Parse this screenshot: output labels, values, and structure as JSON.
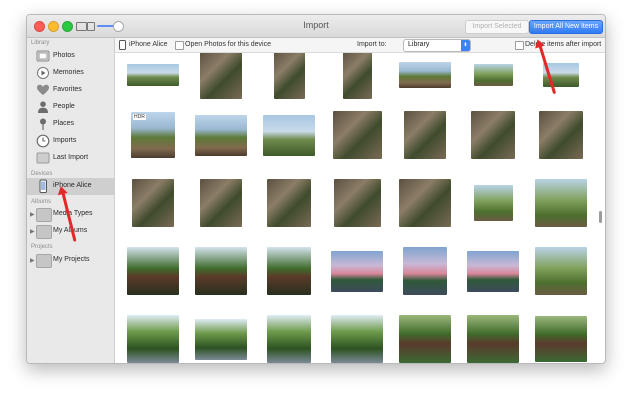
{
  "window": {
    "title": "Import"
  },
  "titlebar": {
    "import_selected_label": "Import Selected",
    "import_all_label": "Import All New Items"
  },
  "toolbar": {
    "device_label": "iPhone Alice",
    "open_photos_label": "Open Photos for this device",
    "import_to_label": "Import to:",
    "import_to_value": "Library",
    "delete_after_label": "Delete items after import"
  },
  "sidebar": {
    "library_header": "Library",
    "library_items": [
      {
        "label": "Photos",
        "icon": "photos-icon"
      },
      {
        "label": "Memories",
        "icon": "memories-icon"
      },
      {
        "label": "Favorites",
        "icon": "heart-icon"
      },
      {
        "label": "People",
        "icon": "person-icon"
      },
      {
        "label": "Places",
        "icon": "pin-icon"
      },
      {
        "label": "Imports",
        "icon": "clock-icon"
      },
      {
        "label": "Last Import",
        "icon": "folder-icon"
      }
    ],
    "devices_header": "Devices",
    "device_item": {
      "label": "iPhone Alice",
      "icon": "phone-icon"
    },
    "albums_header": "Albums",
    "album_items": [
      {
        "label": "Media Types",
        "icon": "folder-icon"
      },
      {
        "label": "My Albums",
        "icon": "folder-icon"
      }
    ],
    "projects_header": "Projects",
    "project_items": [
      {
        "label": "My Projects",
        "icon": "folder-icon"
      }
    ]
  },
  "photos": {
    "badge": "HDR",
    "rows": [
      [
        "sky",
        "rock",
        "rock",
        "rock",
        "people",
        "forest",
        "sky"
      ],
      [
        "people",
        "people",
        "sky",
        "rock",
        "rock",
        "rock",
        "rock"
      ],
      [
        "rock",
        "rock",
        "rock",
        "rock",
        "rock",
        "forest",
        "forest"
      ],
      [
        "pond",
        "pond",
        "pond",
        "sunset",
        "sunset",
        "sunset",
        "forest"
      ],
      [
        "trees",
        "trees",
        "trees",
        "trees",
        "cabin",
        "cabin",
        "cabin"
      ]
    ]
  },
  "colors": {
    "accent": "#3d83f5",
    "annotation_arrow": "#e22828",
    "sidebar_bg": "#e9e9e9"
  }
}
